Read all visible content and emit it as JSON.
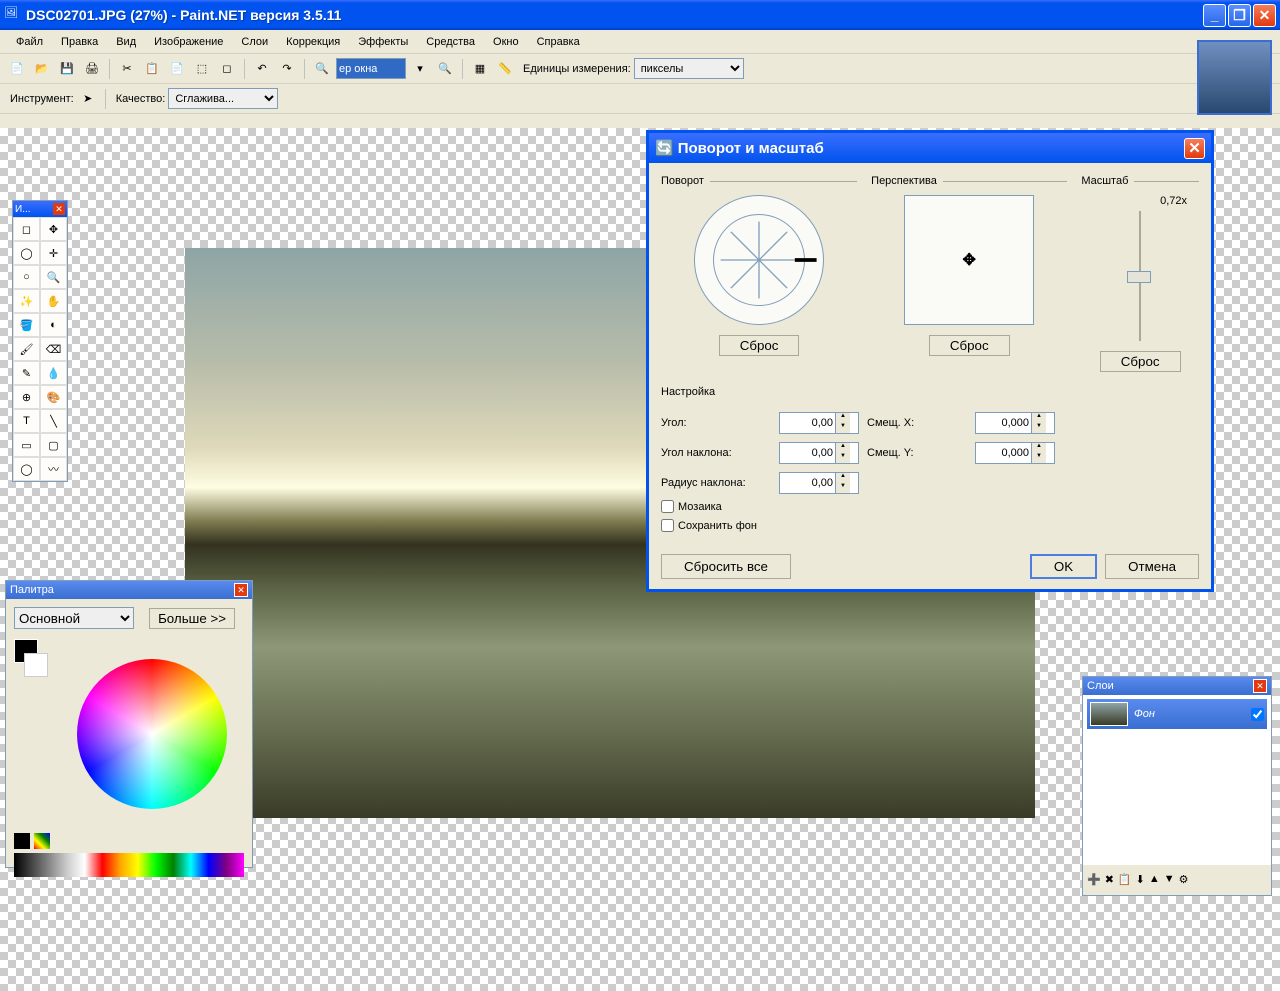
{
  "titlebar": {
    "title": "DSC02701.JPG (27%) - Paint.NET версия 3.5.11"
  },
  "menu": {
    "items": [
      "Файл",
      "Правка",
      "Вид",
      "Изображение",
      "Слои",
      "Коррекция",
      "Эффекты",
      "Средства",
      "Окно",
      "Справка"
    ]
  },
  "toolbar1": {
    "zoom_value": "ер окна",
    "units_label": "Единицы измерения:",
    "units_value": "пикселы"
  },
  "toolbar2": {
    "tool_label": "Инструмент:",
    "quality_label": "Качество:",
    "quality_value": "Сглажива..."
  },
  "tools_window": {
    "title": "И..."
  },
  "palette": {
    "title": "Палитра",
    "mode": "Основной",
    "more": "Больше >>"
  },
  "layers": {
    "title": "Слои",
    "item_name": "Фон"
  },
  "dialog": {
    "title": "Поворот и масштаб",
    "group_rotation": "Поворот",
    "group_perspective": "Перспектива",
    "group_scale": "Масштаб",
    "scale_value": "0,72x",
    "reset": "Сброс",
    "settings_label": "Настройка",
    "angle_label": "Угол:",
    "angle_val": "0,00",
    "tilt_label": "Угол наклона:",
    "tilt_val": "0,00",
    "radius_label": "Радиус наклона:",
    "radius_val": "0,00",
    "offx_label": "Смещ. X:",
    "offx_val": "0,000",
    "offy_label": "Смещ. Y:",
    "offy_val": "0,000",
    "chk_mosaic": "Мозаика",
    "chk_keepbg": "Сохранить фон",
    "reset_all": "Сбросить все",
    "ok": "OK",
    "cancel": "Отмена"
  }
}
